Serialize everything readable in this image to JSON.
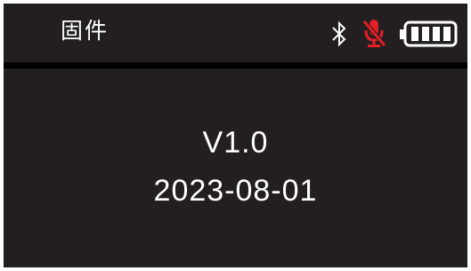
{
  "status_bar": {
    "title": "固件",
    "icons": {
      "bluetooth": "bluetooth-icon",
      "microphone": "microphone-muted-icon",
      "battery": "battery-full-icon"
    },
    "battery_level_bars": 4,
    "battery_level_max": 4
  },
  "firmware": {
    "version": "V1.0",
    "date": "2023-08-01"
  },
  "colors": {
    "background": "#231f20",
    "divider": "#000000",
    "text": "#ffffff",
    "mic_muted": "#e41e25"
  }
}
